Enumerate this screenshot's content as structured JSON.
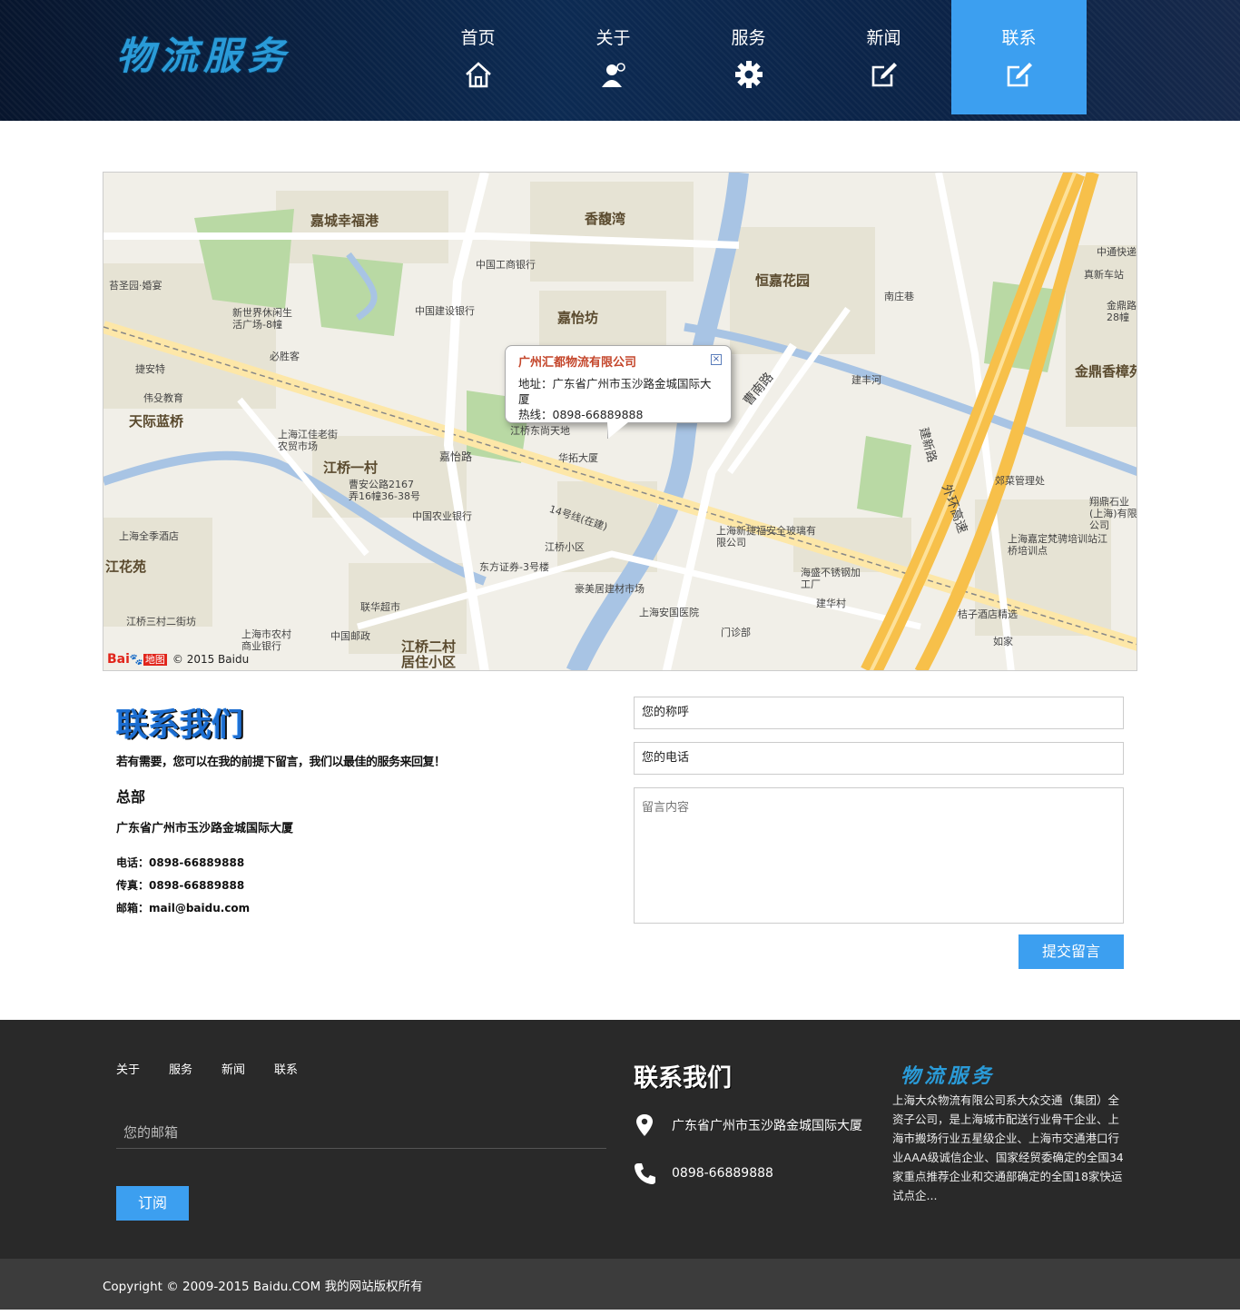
{
  "header": {
    "logo": "物流服务",
    "nav": [
      {
        "label": "首页",
        "icon": "home-icon",
        "active": false
      },
      {
        "label": "关于",
        "icon": "user-icon",
        "active": false
      },
      {
        "label": "服务",
        "icon": "gear-icon",
        "active": false
      },
      {
        "label": "新闻",
        "icon": "edit-icon",
        "active": false
      },
      {
        "label": "联系",
        "icon": "edit-icon",
        "active": true
      }
    ]
  },
  "map": {
    "popup_title": "广州汇都物流有限公司",
    "popup_address": "地址：广东省广州市玉沙路金城国际大厦",
    "popup_phone": "热线：0898-66889888",
    "logo_text": "Bai",
    "logo_suffix": "地图",
    "copyright": "© 2015 Baidu",
    "labels": [
      "嘉城幸福港",
      "香馥湾",
      "恒嘉花园",
      "嘉怡坊",
      "天际蓝桥",
      "江桥一村",
      "江花苑",
      "江桥二村居住小区",
      "金鼎香樟苑",
      "嘉怡路",
      "14号线(在建)",
      "曹南路",
      "建丰河",
      "外环高速",
      "建新路",
      "中国工商银行",
      "中国建设银行",
      "中国农业银行",
      "必胜客",
      "上海全季酒店",
      "东方证券-3号楼",
      "联华超市",
      "中国邮政",
      "上海安国医院",
      "门诊部",
      "豪美居建材市场",
      "江桥东尚天地",
      "华拓大厦",
      "江桥小区",
      "上海新捷福安全玻璃有限公司",
      "海盛不锈钢加工厂",
      "建华村",
      "郊菜管理处",
      "上海嘉定梵骋培训站江桥培训点",
      "桔子酒店精选",
      "如家",
      "中通快递",
      "真新车站",
      "南庄巷",
      "翔鼎石业(上海)有限公司",
      "捷安特",
      "伟殳教育",
      "苔圣园·婚宴",
      "新世界休闲生活广场-8幢",
      "上海江佳老街农贸市场",
      "曹安公路2167弄16幢36-38号",
      "江桥三村二街坊",
      "上海市农村商业银行",
      "金鼎路28幢"
    ]
  },
  "contact": {
    "title": "联系我们",
    "intro": "若有需要，您可以在我的前提下留言，我们以最佳的服务来回复！",
    "sub_title": "总部",
    "address": "广东省广州市玉沙路金城国际大厦",
    "phone": "电话：0898-66889888",
    "fax": "传真：0898-66889888",
    "email": "邮箱：mail@baidu.com"
  },
  "form": {
    "name_value": "您的称呼",
    "phone_value": "您的电话",
    "message_placeholder": "留言内容",
    "submit_label": "提交留言"
  },
  "footer": {
    "links": [
      "关于",
      "服务",
      "新闻",
      "联系"
    ],
    "email_placeholder": "您的邮箱",
    "subscribe_label": "订阅",
    "contact_title": "联系我们",
    "address": "广东省广州市玉沙路金城国际大厦",
    "phone": "0898-66889888",
    "logo": "物流服务",
    "description": "上海大众物流有限公司系大众交通（集团）全资子公司，是上海城市配送行业骨干企业、上海市搬场行业五星级企业、上海市交通港口行业AAA级诚信企业、国家经贸委确定的全国34家重点推荐企业和交通部确定的全国18家快运试点企..."
  },
  "copyright": "Copyright © 2009-2015 Baidu.COM 我的网站版权所有",
  "colors": {
    "accent": "#3c9ff0",
    "footer_bg": "#292929",
    "copyright_bg": "#3c3c3c",
    "title_blue": "#1c6dd0"
  }
}
